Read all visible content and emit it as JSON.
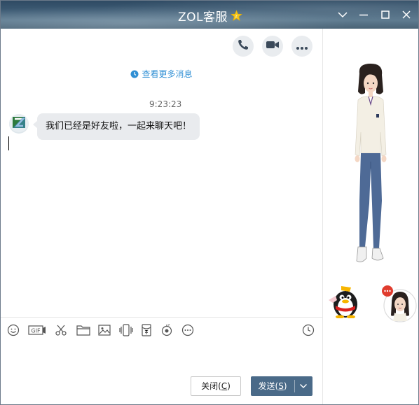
{
  "window": {
    "title": "ZOL客服",
    "controls": [
      "minimize-dropdown",
      "minimize",
      "maximize",
      "close"
    ]
  },
  "header_actions": [
    "phone-icon",
    "video-icon",
    "more-icon"
  ],
  "history_link": "查看更多消息",
  "messages": [
    {
      "time": "9:23:23",
      "sender_avatar": "zol-logo",
      "text": "我们已经是好友啦，一起来聊天吧！"
    }
  ],
  "toolbar": {
    "items": [
      "emoji-icon",
      "gif-icon",
      "screenshot-icon",
      "folder-icon",
      "image-icon",
      "shake-icon",
      "red-packet-icon",
      "voice-icon",
      "more-icon",
      "history-icon"
    ]
  },
  "buttons": {
    "close_label": "关闭(",
    "close_key": "C",
    "close_end": ")",
    "send_label": "发送(",
    "send_key": "S",
    "send_end": ")"
  },
  "colors": {
    "link": "#2f8fd4",
    "send_button": "#4a6a88",
    "bubble": "#e9ebee",
    "title_bar": "#3c5a73"
  }
}
